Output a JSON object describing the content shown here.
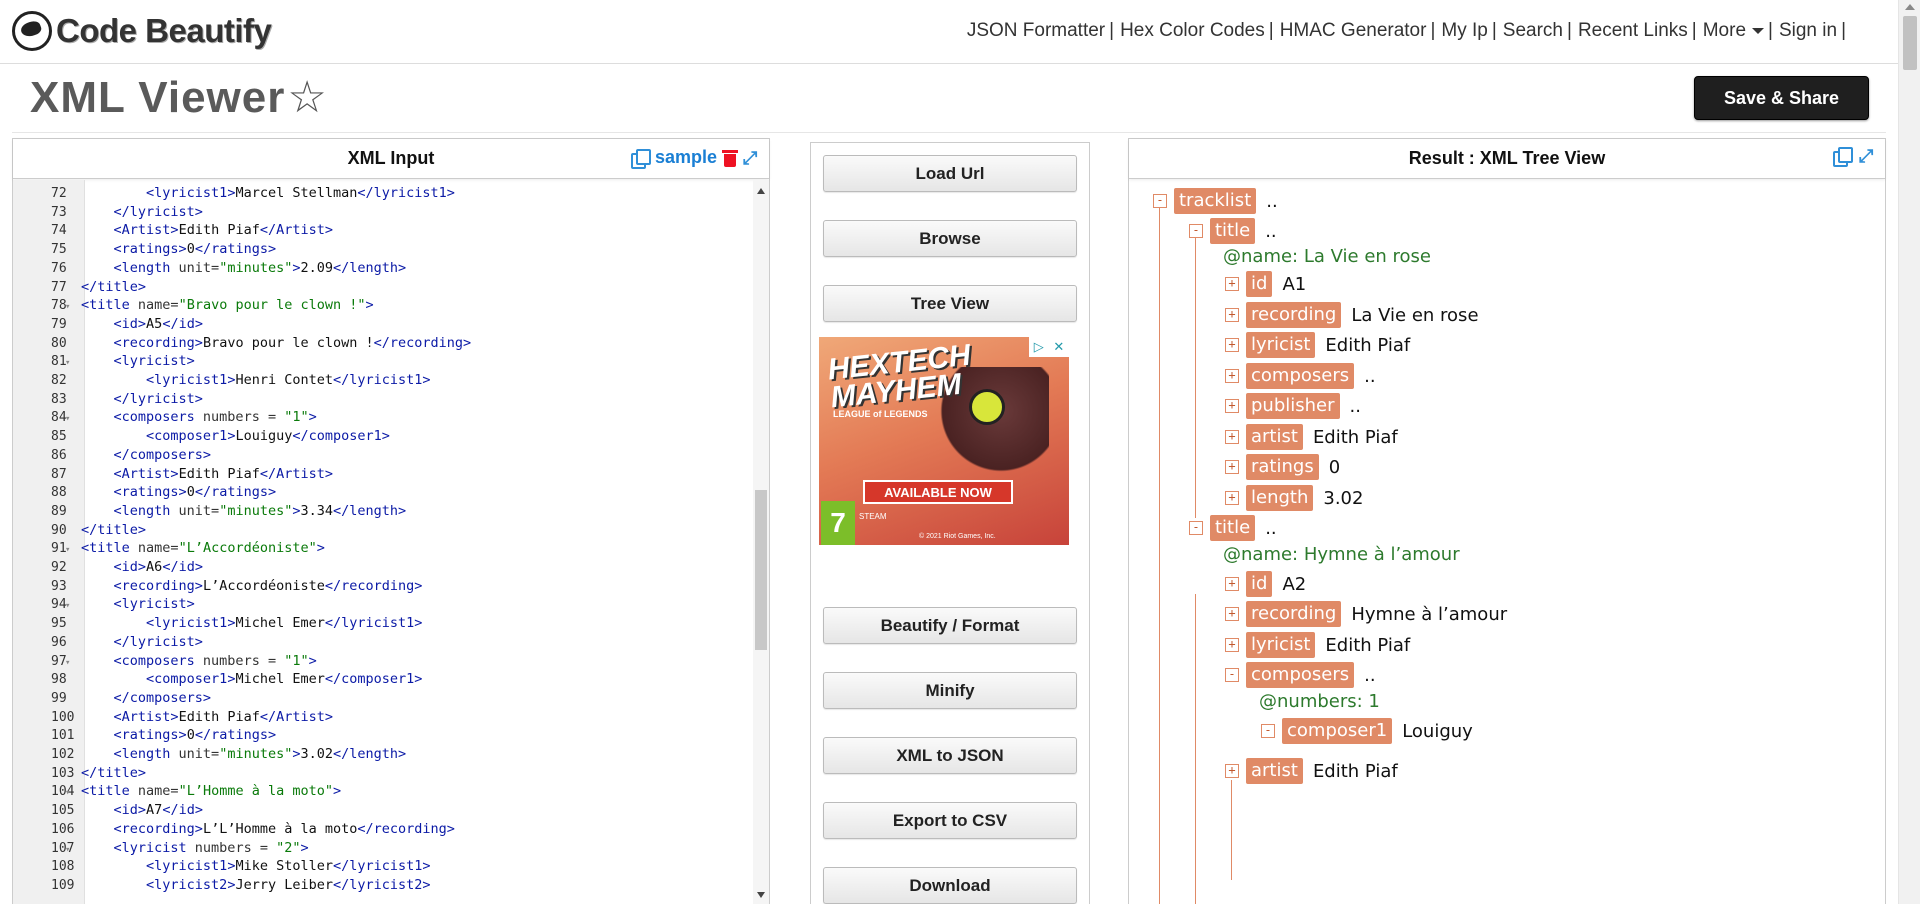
{
  "brand": {
    "name": "Code Beautify"
  },
  "nav": {
    "links": [
      "JSON Formatter",
      "Hex Color Codes",
      "HMAC Generator",
      "My Ip",
      "Search",
      "Recent Links",
      "More",
      "Sign in"
    ]
  },
  "page": {
    "title": "XML Viewer",
    "save_label": "Save & Share"
  },
  "input_panel": {
    "title": "XML Input",
    "sample_label": "sample",
    "lines": [
      {
        "n": "72",
        "f": "",
        "code": "        <lyricist1>Marcel Stellman</lyricist1>"
      },
      {
        "n": "73",
        "f": "",
        "code": "    </lyricist>"
      },
      {
        "n": "74",
        "f": "",
        "code": "    <Artist>Edith Piaf</Artist>"
      },
      {
        "n": "75",
        "f": "",
        "code": "    <ratings>0</ratings>"
      },
      {
        "n": "76",
        "f": "",
        "code": "    <length unit=\"minutes\">2.09</length>"
      },
      {
        "n": "77",
        "f": "",
        "code": "</title>"
      },
      {
        "n": "78",
        "f": "▾",
        "code": "<title name=\"Bravo pour le clown !\">"
      },
      {
        "n": "79",
        "f": "",
        "code": "    <id>A5</id>"
      },
      {
        "n": "80",
        "f": "",
        "code": "    <recording>Bravo pour le clown !</recording>"
      },
      {
        "n": "81",
        "f": "▾",
        "code": "    <lyricist>"
      },
      {
        "n": "82",
        "f": "",
        "code": "        <lyricist1>Henri Contet</lyricist1>"
      },
      {
        "n": "83",
        "f": "",
        "code": "    </lyricist>"
      },
      {
        "n": "84",
        "f": "▾",
        "code": "    <composers numbers = \"1\">"
      },
      {
        "n": "85",
        "f": "",
        "code": "        <composer1>Louiguy</composer1>"
      },
      {
        "n": "86",
        "f": "",
        "code": "    </composers>"
      },
      {
        "n": "87",
        "f": "",
        "code": "    <Artist>Edith Piaf</Artist>"
      },
      {
        "n": "88",
        "f": "",
        "code": "    <ratings>0</ratings>"
      },
      {
        "n": "89",
        "f": "",
        "code": "    <length unit=\"minutes\">3.34</length>"
      },
      {
        "n": "90",
        "f": "",
        "code": "</title>"
      },
      {
        "n": "91",
        "f": "▾",
        "code": "<title name=\"L’Accordéoniste\">"
      },
      {
        "n": "92",
        "f": "",
        "code": "    <id>A6</id>"
      },
      {
        "n": "93",
        "f": "",
        "code": "    <recording>L’Accordéoniste</recording>"
      },
      {
        "n": "94",
        "f": "▾",
        "code": "    <lyricist>"
      },
      {
        "n": "95",
        "f": "",
        "code": "        <lyricist1>Michel Emer</lyricist1>"
      },
      {
        "n": "96",
        "f": "",
        "code": "    </lyricist>"
      },
      {
        "n": "97",
        "f": "▾",
        "code": "    <composers numbers = \"1\">"
      },
      {
        "n": "98",
        "f": "",
        "code": "        <composer1>Michel Emer</composer1>"
      },
      {
        "n": "99",
        "f": "",
        "code": "    </composers>"
      },
      {
        "n": "100",
        "f": "",
        "code": "    <Artist>Edith Piaf</Artist>"
      },
      {
        "n": "101",
        "f": "",
        "code": "    <ratings>0</ratings>"
      },
      {
        "n": "102",
        "f": "",
        "code": "    <length unit=\"minutes\">3.02</length>"
      },
      {
        "n": "103",
        "f": "",
        "code": "</title>"
      },
      {
        "n": "104",
        "f": "▾",
        "code": "<title name=\"L’Homme à la moto\">"
      },
      {
        "n": "105",
        "f": "",
        "code": "    <id>A7</id>"
      },
      {
        "n": "106",
        "f": "",
        "code": "    <recording>L’L’Homme à la moto</recording>"
      },
      {
        "n": "107",
        "f": "▾",
        "code": "    <lyricist numbers = \"2\">"
      },
      {
        "n": "108",
        "f": "",
        "code": "        <lyricist1>Mike Stoller</lyricist1>"
      },
      {
        "n": "109",
        "f": "",
        "code": "        <lyricist2>Jerry Leiber</lyricist2>"
      }
    ]
  },
  "actions": {
    "load_url": "Load Url",
    "browse": "Browse",
    "tree_view": "Tree View",
    "beautify": "Beautify / Format",
    "minify": "Minify",
    "xml_to_json": "XML to JSON",
    "export_csv": "Export to CSV",
    "download": "Download"
  },
  "ad": {
    "title_line1": "HEXTECH",
    "title_line2": "MAYHEM",
    "subtitle": "LEAGUE of LEGENDS",
    "banner": "AVAILABLE NOW",
    "rating": "7",
    "platforms": "STEAM",
    "copyright": "© 2021 Riot Games, Inc."
  },
  "result_panel": {
    "title": "Result : XML Tree View",
    "nodes": [
      {
        "tag": "tracklist",
        "val": "..",
        "tog": "-"
      },
      {
        "tag": "title",
        "val": "..",
        "tog": "-"
      },
      {
        "attr": "@name:  La Vie en rose"
      },
      {
        "tag": "id",
        "val": "A1",
        "tog": "+"
      },
      {
        "tag": "recording",
        "val": "La Vie en rose",
        "tog": "+"
      },
      {
        "tag": "lyricist",
        "val": "Edith Piaf",
        "tog": "+"
      },
      {
        "tag": "composers",
        "val": "..",
        "tog": "+"
      },
      {
        "tag": "publisher",
        "val": "..",
        "tog": "+"
      },
      {
        "tag": "artist",
        "val": "Edith Piaf",
        "tog": "+"
      },
      {
        "tag": "ratings",
        "val": "0",
        "tog": "+"
      },
      {
        "tag": "length",
        "val": "3.02",
        "tog": "+"
      },
      {
        "tag": "title",
        "val": "..",
        "tog": "-"
      },
      {
        "attr": "@name:  Hymne à l’amour"
      },
      {
        "tag": "id",
        "val": "A2",
        "tog": "+"
      },
      {
        "tag": "recording",
        "val": "Hymne à l’amour",
        "tog": "+"
      },
      {
        "tag": "lyricist",
        "val": "Edith Piaf",
        "tog": "+"
      },
      {
        "tag": "composers",
        "val": "..",
        "tog": "-"
      },
      {
        "attr": "@numbers:  1"
      },
      {
        "tag": "composer1",
        "val": "Louiguy",
        "tog": "-"
      },
      {
        "tag": "artist",
        "val": "Edith Piaf",
        "tog": "+"
      }
    ]
  }
}
